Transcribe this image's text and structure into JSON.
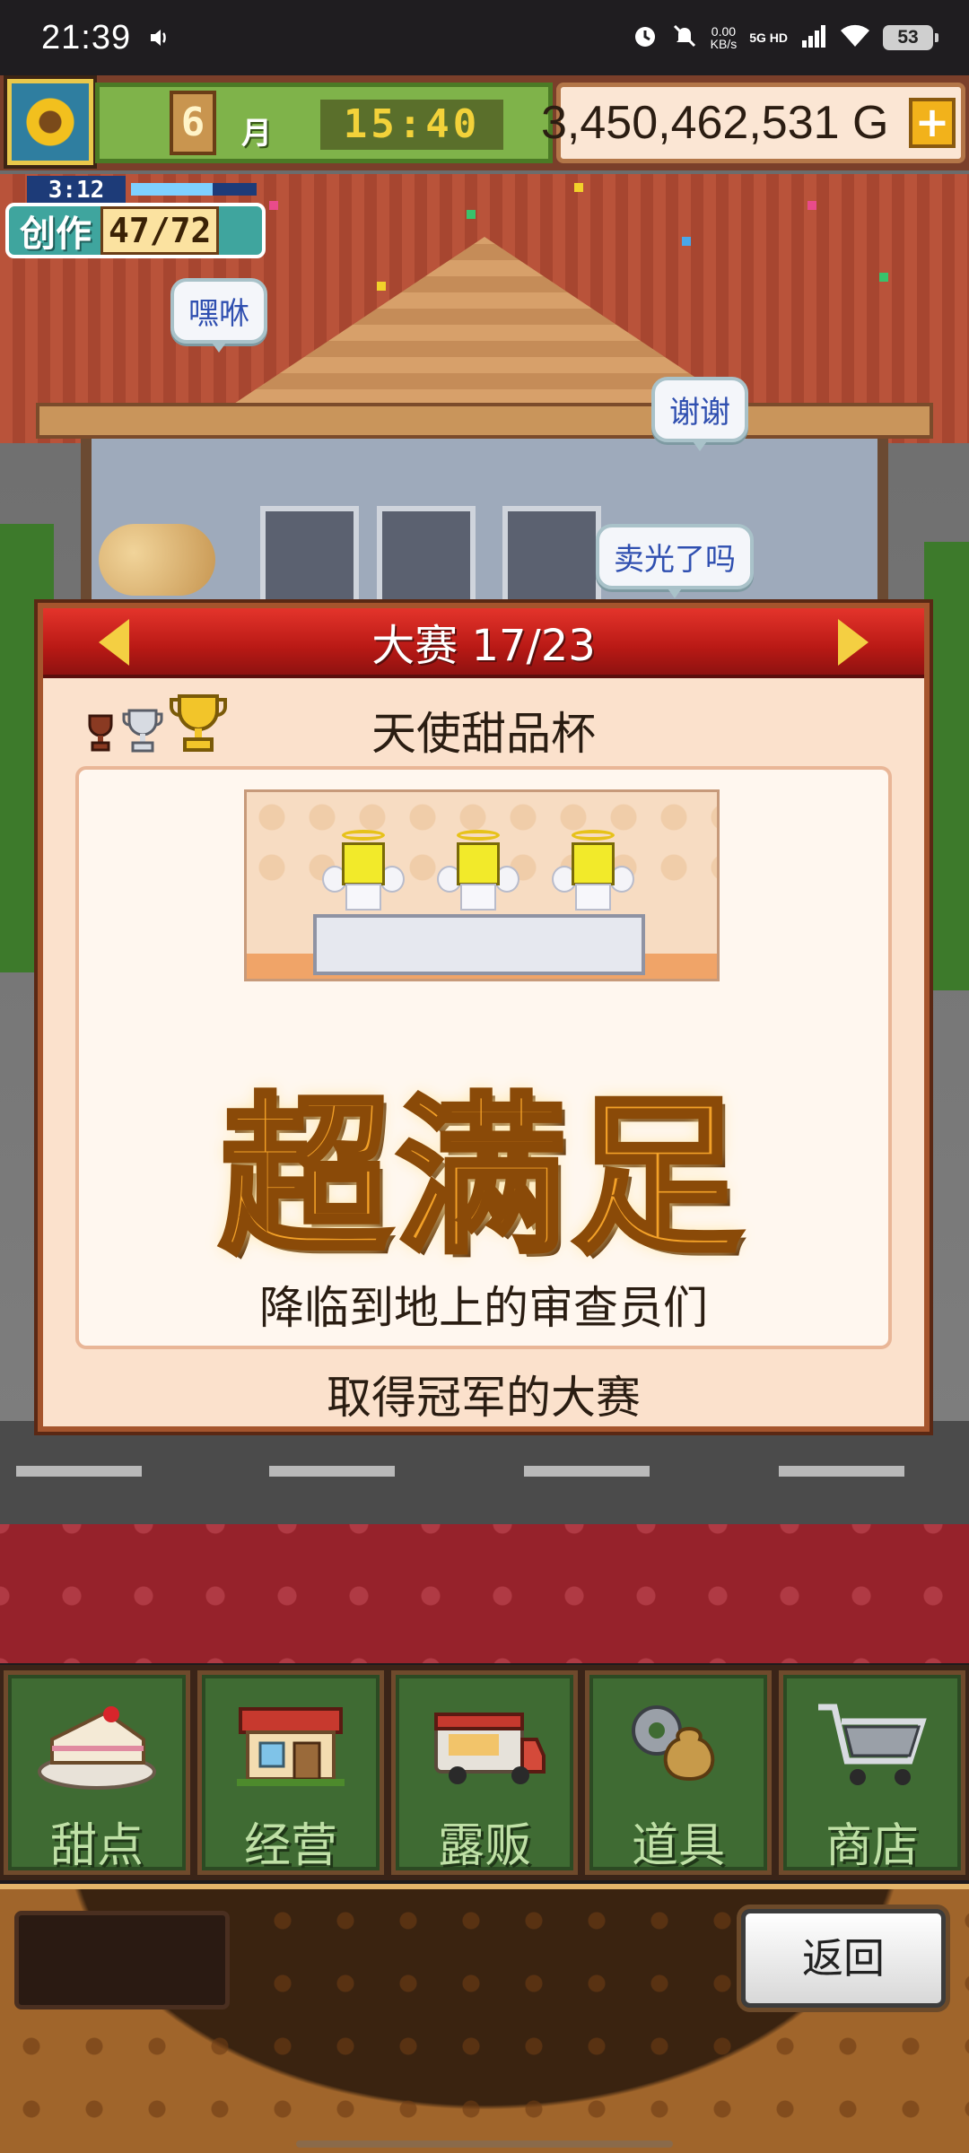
{
  "status_bar": {
    "time": "21:39",
    "net_speed": "0.00",
    "net_unit": "KB/s",
    "network": "5G HD",
    "battery": "53"
  },
  "hud": {
    "month_number": "6",
    "month_label": "月",
    "clock": "15:40",
    "money": "3,450,462,531 G",
    "plus_label": "+"
  },
  "creation": {
    "timer": "3:12",
    "label": "创作",
    "count": "47/72",
    "progress_fraction": 0.65
  },
  "bubbles": {
    "b1": "嘿咻",
    "b2": "谢谢",
    "b3": "卖光了吗"
  },
  "contest": {
    "header": "大赛 17/23",
    "cup_name": "天使甜品杯",
    "rating": "超满足",
    "judges_caption": "降临到地上的审查员们",
    "footer": "取得冠军的大赛"
  },
  "menu": {
    "items": [
      {
        "label": "甜点",
        "icon": "cake-icon"
      },
      {
        "label": "经营",
        "icon": "shop-icon"
      },
      {
        "label": "露贩",
        "icon": "food-truck-icon"
      },
      {
        "label": "道具",
        "icon": "item-bag-icon"
      },
      {
        "label": "商店",
        "icon": "shopping-cart-icon"
      }
    ]
  },
  "back_button": "返回",
  "colors": {
    "header_red": "#c4201a",
    "panel_bg": "#fbe1cc",
    "rating_gold": "#f3a128",
    "menu_green": "#3f6b33"
  }
}
